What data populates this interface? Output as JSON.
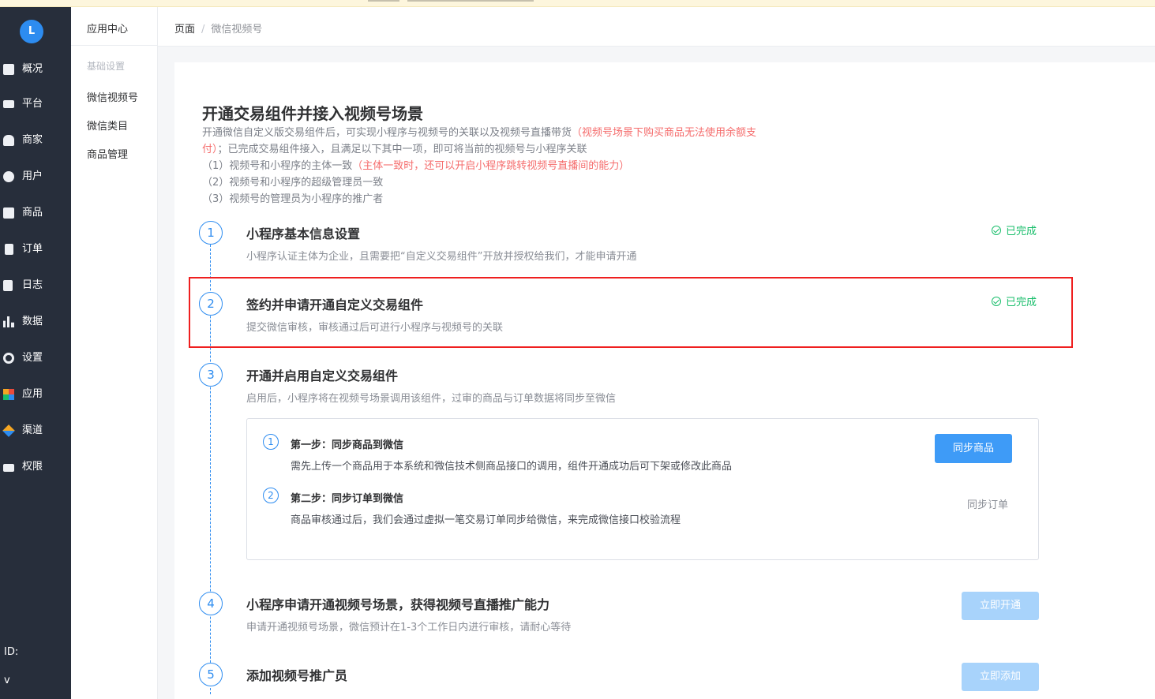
{
  "nav": {
    "logo_text": "L",
    "items": [
      {
        "label": "概况",
        "icon": "dashboard-icon"
      },
      {
        "label": "平台",
        "icon": "monitor-icon"
      },
      {
        "label": "商家",
        "icon": "store-icon"
      },
      {
        "label": "用户",
        "icon": "user-icon"
      },
      {
        "label": "商品",
        "icon": "product-icon"
      },
      {
        "label": "订单",
        "icon": "order-icon"
      },
      {
        "label": "日志",
        "icon": "log-icon"
      },
      {
        "label": "数据",
        "icon": "chart-icon"
      },
      {
        "label": "设置",
        "icon": "gear-icon"
      },
      {
        "label": "应用",
        "icon": "apps-icon"
      },
      {
        "label": "渠道",
        "icon": "channel-icon"
      },
      {
        "label": "权限",
        "icon": "lock-icon"
      }
    ],
    "footer_id": "ID:",
    "footer_version": "v"
  },
  "subnav": {
    "title": "应用中心",
    "group": "基础设置",
    "items": [
      "微信视频号",
      "微信类目",
      "商品管理"
    ]
  },
  "breadcrumb": {
    "root": "页面",
    "separator": "/",
    "current": "微信视频号"
  },
  "page": {
    "title": "开通交易组件并接入视频号场景",
    "desc_line1": "开通微信自定义版交易组件后，可实现小程序与视频号的关联以及视频号直播带货",
    "desc_line1_red": "（视频号场景下购买商品无法使用余额支",
    "desc_line2_red": "付）",
    "desc_line2": "；已完成交易组件接入，且满足以下其中一项，即可将当前的视频号与小程序关联",
    "cond1": "（1）视频号和小程序的主体一致",
    "cond1_red": "（主体一致时，还可以开启小程序跳转视频号直播间的能力）",
    "cond2": "（2）视频号和小程序的超级管理员一致",
    "cond3": "（3）视频号的管理员为小程序的推广者"
  },
  "steps": [
    {
      "num": "1",
      "title": "小程序基本信息设置",
      "desc": "小程序认证主体为企业，且需要把“自定义交易组件”开放并授权给我们，才能申请开通",
      "status": "已完成"
    },
    {
      "num": "2",
      "title": "签约并申请开通自定义交易组件",
      "desc": "提交微信审核，审核通过后可进行小程序与视频号的关联",
      "status": "已完成"
    },
    {
      "num": "3",
      "title": "开通并启用自定义交易组件",
      "desc": "启用后，小程序将在视频号场景调用该组件，过审的商品与订单数据将同步至微信"
    },
    {
      "num": "4",
      "title": "小程序申请开通视频号场景，获得视频号直播推广能力",
      "desc": "申请开通视频号场景，微信预计在1-3个工作日内进行审核，请耐心等待",
      "button": "立即开通"
    },
    {
      "num": "5",
      "title": "添加视频号推广员",
      "button": "立即添加"
    }
  ],
  "substeps": [
    {
      "num": "1",
      "title": "第一步：同步商品到微信",
      "desc": "需先上传一个商品用于本系统和微信技术侧商品接口的调用，组件开通成功后可下架或修改此商品",
      "action": "同步商品"
    },
    {
      "num": "2",
      "title": "第二步：同步订单到微信",
      "desc": "商品审核通过后，我们会通过虚拟一笔交易订单同步给微信，来完成微信接口校验流程",
      "action": "同步订单"
    }
  ],
  "colors": {
    "primary": "#2d8cf0",
    "success": "#19be6b",
    "danger": "#f56c6c",
    "highlight": "#ef1f1f",
    "sidebar": "#272e3b"
  }
}
